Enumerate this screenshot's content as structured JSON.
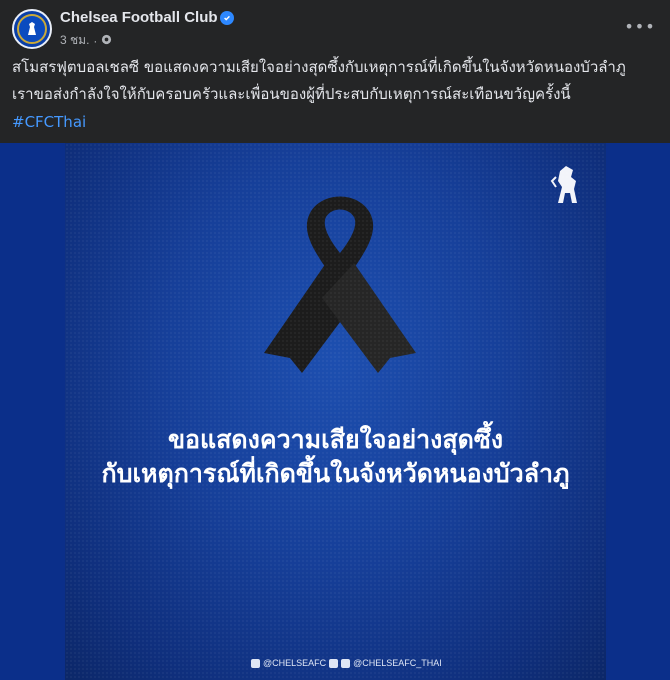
{
  "post": {
    "page_name": "Chelsea Football Club",
    "time": "3 ชม.",
    "separator": "·",
    "more_icon": "more-horizontal-icon",
    "caption_lines": [
      "สโมสรฟุตบอลเชลซี ขอแสดงความเสียใจอย่างสุดซึ้งกับเหตุการณ์ที่เกิดขึ้นในจังหวัดหนองบัวลำภู",
      "เราขอส่งกำลังใจให้กับครอบครัวและเพื่อนของผู้ที่ประสบกับเหตุการณ์สะเทือนขวัญครั้งนี้"
    ],
    "hashtag": "#CFCThai"
  },
  "image": {
    "headline_lines": [
      "ขอแสดงความเสียใจอย่างสุดซึ้ง",
      "กับเหตุการณ์ที่เกิดขึ้นในจังหวัดหนองบัวลำภู"
    ],
    "handle_1": "@CHELSEAFC",
    "handle_2": "@CHELSEAFC_THAI",
    "colors": {
      "background": "#163f99",
      "ribbon": "#1c1c1c"
    }
  }
}
